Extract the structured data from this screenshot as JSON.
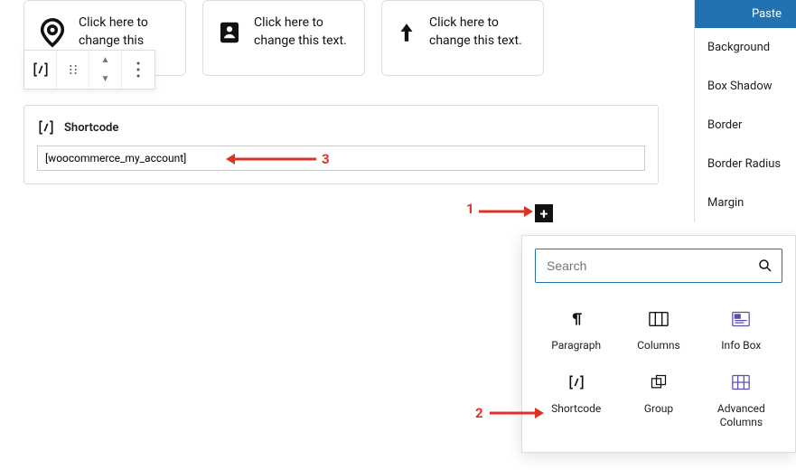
{
  "cards": [
    {
      "text": "Click here to change this",
      "icon": "location-pin-icon"
    },
    {
      "text": "Click here to change this text.",
      "icon": "contact-icon"
    },
    {
      "text": "Click here to change this text.",
      "icon": "arrow-up-icon"
    }
  ],
  "shortcode": {
    "title": "Shortcode",
    "value": "[woocommerce_my_account]"
  },
  "sidebar": {
    "paste": "Paste",
    "items": [
      "Background",
      "Box Shadow",
      "Border",
      "Border Radius",
      "Margin"
    ]
  },
  "inserter": {
    "search_placeholder": "Search",
    "blocks": [
      {
        "label": "Paragraph",
        "icon": "paragraph-icon"
      },
      {
        "label": "Columns",
        "icon": "columns-icon"
      },
      {
        "label": "Info Box",
        "icon": "infobox-icon"
      },
      {
        "label": "Shortcode",
        "icon": "shortcode-icon"
      },
      {
        "label": "Group",
        "icon": "group-icon"
      },
      {
        "label": "Advanced Columns",
        "icon": "advcolumns-icon"
      }
    ]
  },
  "annotations": {
    "one": "1",
    "two": "2",
    "three": "3"
  }
}
